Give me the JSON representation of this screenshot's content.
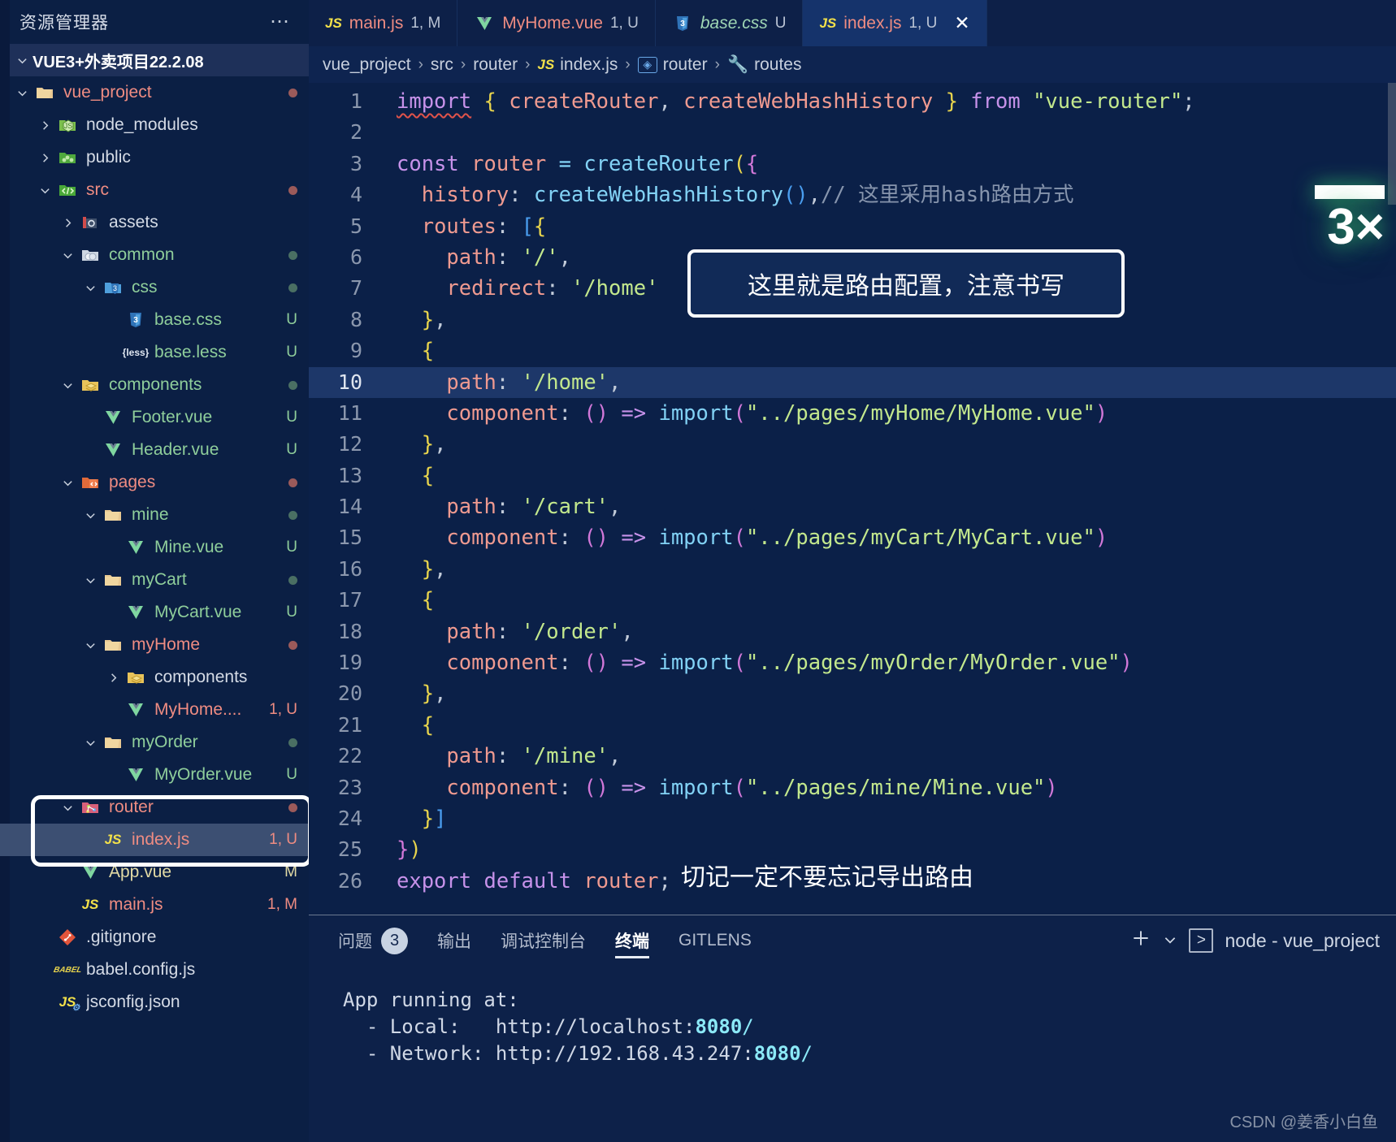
{
  "sidebar": {
    "title": "资源管理器",
    "more_icon": "ellipsis-icon",
    "root": "VUE3+外卖项目22.2.08",
    "items": [
      {
        "label": "vue_project",
        "badge": "",
        "indent": 1,
        "icon": "folder-open-icon",
        "color": "red",
        "arrow": "down",
        "dot": "red"
      },
      {
        "label": "node_modules",
        "badge": "",
        "indent": 2,
        "icon": "node-folder-icon",
        "color": "plain",
        "arrow": "right",
        "dot": ""
      },
      {
        "label": "public",
        "badge": "",
        "indent": 2,
        "icon": "public-folder-icon",
        "color": "plain",
        "arrow": "right",
        "dot": ""
      },
      {
        "label": "src",
        "badge": "",
        "indent": 2,
        "icon": "src-folder-icon",
        "color": "red",
        "arrow": "down",
        "dot": "red"
      },
      {
        "label": "assets",
        "badge": "",
        "indent": 3,
        "icon": "assets-folder-icon",
        "color": "plain",
        "arrow": "right",
        "dot": ""
      },
      {
        "label": "common",
        "badge": "",
        "indent": 3,
        "icon": "common-folder-icon",
        "color": "green",
        "arrow": "down",
        "dot": "green"
      },
      {
        "label": "css",
        "badge": "",
        "indent": 4,
        "icon": "css-folder-icon",
        "color": "green",
        "arrow": "down",
        "dot": "green"
      },
      {
        "label": "base.css",
        "badge": "U",
        "indent": 5,
        "icon": "css-file-icon",
        "color": "green",
        "arrow": "",
        "dot": ""
      },
      {
        "label": "base.less",
        "badge": "U",
        "indent": 5,
        "icon": "less-file-icon",
        "color": "green",
        "arrow": "",
        "dot": ""
      },
      {
        "label": "components",
        "badge": "",
        "indent": 3,
        "icon": "components-folder-icon",
        "color": "green",
        "arrow": "down",
        "dot": "green"
      },
      {
        "label": "Footer.vue",
        "badge": "U",
        "indent": 4,
        "icon": "vue-file-icon",
        "color": "green",
        "arrow": "",
        "dot": ""
      },
      {
        "label": "Header.vue",
        "badge": "U",
        "indent": 4,
        "icon": "vue-file-icon",
        "color": "green",
        "arrow": "",
        "dot": ""
      },
      {
        "label": "pages",
        "badge": "",
        "indent": 3,
        "icon": "pages-folder-icon",
        "color": "red",
        "arrow": "down",
        "dot": "red"
      },
      {
        "label": "mine",
        "badge": "",
        "indent": 4,
        "icon": "folder-open-icon",
        "color": "green",
        "arrow": "down",
        "dot": "green"
      },
      {
        "label": "Mine.vue",
        "badge": "U",
        "indent": 5,
        "icon": "vue-file-icon",
        "color": "green",
        "arrow": "",
        "dot": ""
      },
      {
        "label": "myCart",
        "badge": "",
        "indent": 4,
        "icon": "folder-open-icon",
        "color": "green",
        "arrow": "down",
        "dot": "green"
      },
      {
        "label": "MyCart.vue",
        "badge": "U",
        "indent": 5,
        "icon": "vue-file-icon",
        "color": "green",
        "arrow": "",
        "dot": ""
      },
      {
        "label": "myHome",
        "badge": "",
        "indent": 4,
        "icon": "folder-open-icon",
        "color": "red",
        "arrow": "down",
        "dot": "red"
      },
      {
        "label": "components",
        "badge": "",
        "indent": 5,
        "icon": "components-folder-icon",
        "color": "plain",
        "arrow": "right",
        "dot": ""
      },
      {
        "label": "MyHome....",
        "badge": "1, U",
        "indent": 5,
        "icon": "vue-file-icon",
        "color": "red",
        "arrow": "",
        "dot": ""
      },
      {
        "label": "myOrder",
        "badge": "",
        "indent": 4,
        "icon": "folder-open-icon",
        "color": "green",
        "arrow": "down",
        "dot": "green"
      },
      {
        "label": "MyOrder.vue",
        "badge": "U",
        "indent": 5,
        "icon": "vue-file-icon",
        "color": "green",
        "arrow": "",
        "dot": ""
      },
      {
        "label": "router",
        "badge": "",
        "indent": 3,
        "icon": "router-folder-icon",
        "color": "red",
        "arrow": "down",
        "dot": "red"
      },
      {
        "label": "index.js",
        "badge": "1, U",
        "indent": 4,
        "icon": "js-file-icon",
        "color": "red",
        "arrow": "",
        "dot": "",
        "selected": true
      },
      {
        "label": "App.vue",
        "badge": "M",
        "indent": 3,
        "icon": "vue-file-icon",
        "color": "yellow",
        "arrow": "",
        "dot": ""
      },
      {
        "label": "main.js",
        "badge": "1, M",
        "indent": 3,
        "icon": "js-file-icon",
        "color": "red",
        "arrow": "",
        "dot": ""
      },
      {
        "label": ".gitignore",
        "badge": "",
        "indent": 2,
        "icon": "git-file-icon",
        "color": "plain",
        "arrow": "",
        "dot": ""
      },
      {
        "label": "babel.config.js",
        "badge": "",
        "indent": 2,
        "icon": "babel-file-icon",
        "color": "plain",
        "arrow": "",
        "dot": ""
      },
      {
        "label": "jsconfig.json",
        "badge": "",
        "indent": 2,
        "icon": "jsconfig-file-icon",
        "color": "plain",
        "arrow": "",
        "dot": ""
      }
    ]
  },
  "tabs": [
    {
      "icon": "js-file-icon",
      "name": "main.js",
      "badge": "1, M",
      "active": false,
      "close": false
    },
    {
      "icon": "vue-file-icon",
      "name": "MyHome.vue",
      "badge": "1, U",
      "active": false,
      "close": false
    },
    {
      "icon": "css-file-icon",
      "name": "base.css",
      "badge": "U",
      "active": false,
      "close": false
    },
    {
      "icon": "js-file-icon",
      "name": "index.js",
      "badge": "1, U",
      "active": true,
      "close": true
    }
  ],
  "breadcrumb": [
    {
      "label": "vue_project",
      "icon": ""
    },
    {
      "label": "src",
      "icon": ""
    },
    {
      "label": "router",
      "icon": ""
    },
    {
      "label": "index.js",
      "icon": "js-file-icon"
    },
    {
      "label": "router",
      "icon": "symbol-variable-icon"
    },
    {
      "label": "routes",
      "icon": "symbol-property-icon"
    }
  ],
  "code": {
    "current_line": 10,
    "lines": [
      {
        "n": 1,
        "html": "<span class='t-kw squiggle'>import</span> <span class='t-br1'>{</span> <span class='t-var'>createRouter</span><span class='t-punc'>,</span> <span class='t-var'>createWebHashHistory</span> <span class='t-br1'>}</span> <span class='t-kw'>from</span> <span class='t-str'>\"vue-router\"</span><span class='t-punc'>;</span>"
      },
      {
        "n": 2,
        "html": ""
      },
      {
        "n": 3,
        "html": "<span class='t-kw'>const</span> <span class='t-var'>router</span> <span class='t-op'>=</span> <span class='t-fn'>createRouter</span><span class='t-br1'>(</span><span class='t-br2'>{</span>"
      },
      {
        "n": 4,
        "html": "  <span class='t-prop'>history</span><span class='t-punc'>:</span> <span class='t-fn'>createWebHashHistory</span><span class='t-br3'>()</span><span class='t-punc'>,</span><span class='t-cmt'>// 这里采用hash路由方式</span>"
      },
      {
        "n": 5,
        "html": "  <span class='t-prop'>routes</span><span class='t-punc'>:</span> <span class='t-br3'>[</span><span class='t-br1'>{</span>"
      },
      {
        "n": 6,
        "html": "    <span class='t-prop'>path</span><span class='t-punc'>:</span> <span class='t-str'>'/'</span><span class='t-punc'>,</span>"
      },
      {
        "n": 7,
        "html": "    <span class='t-prop'>redirect</span><span class='t-punc'>:</span> <span class='t-str'>'/home'</span>"
      },
      {
        "n": 8,
        "html": "  <span class='t-br1'>}</span><span class='t-punc'>,</span>"
      },
      {
        "n": 9,
        "html": "  <span class='t-br1'>{</span>"
      },
      {
        "n": 10,
        "html": "    <span class='t-prop'>path</span><span class='t-punc'>:</span> <span class='t-str'>'/home'</span><span class='t-punc'>,</span>"
      },
      {
        "n": 11,
        "html": "    <span class='t-prop'>component</span><span class='t-punc'>:</span> <span class='t-paren'>()</span> <span class='t-arrow'>=&gt;</span> <span class='t-fn'>import</span><span class='t-paren'>(</span><span class='t-str'>\"../pages/myHome/MyHome.vue\"</span><span class='t-paren'>)</span>"
      },
      {
        "n": 12,
        "html": "  <span class='t-br1'>}</span><span class='t-punc'>,</span>"
      },
      {
        "n": 13,
        "html": "  <span class='t-br1'>{</span>"
      },
      {
        "n": 14,
        "html": "    <span class='t-prop'>path</span><span class='t-punc'>:</span> <span class='t-str'>'/cart'</span><span class='t-punc'>,</span>"
      },
      {
        "n": 15,
        "html": "    <span class='t-prop'>component</span><span class='t-punc'>:</span> <span class='t-paren'>()</span> <span class='t-arrow'>=&gt;</span> <span class='t-fn'>import</span><span class='t-paren'>(</span><span class='t-str'>\"../pages/myCart/MyCart.vue\"</span><span class='t-paren'>)</span>"
      },
      {
        "n": 16,
        "html": "  <span class='t-br1'>}</span><span class='t-punc'>,</span>"
      },
      {
        "n": 17,
        "html": "  <span class='t-br1'>{</span>"
      },
      {
        "n": 18,
        "html": "    <span class='t-prop'>path</span><span class='t-punc'>:</span> <span class='t-str'>'/order'</span><span class='t-punc'>,</span>"
      },
      {
        "n": 19,
        "html": "    <span class='t-prop'>component</span><span class='t-punc'>:</span> <span class='t-paren'>()</span> <span class='t-arrow'>=&gt;</span> <span class='t-fn'>import</span><span class='t-paren'>(</span><span class='t-str'>\"../pages/myOrder/MyOrder.vue\"</span><span class='t-paren'>)</span>"
      },
      {
        "n": 20,
        "html": "  <span class='t-br1'>}</span><span class='t-punc'>,</span>"
      },
      {
        "n": 21,
        "html": "  <span class='t-br1'>{</span>"
      },
      {
        "n": 22,
        "html": "    <span class='t-prop'>path</span><span class='t-punc'>:</span> <span class='t-str'>'/mine'</span><span class='t-punc'>,</span>"
      },
      {
        "n": 23,
        "html": "    <span class='t-prop'>component</span><span class='t-punc'>:</span> <span class='t-paren'>()</span> <span class='t-arrow'>=&gt;</span> <span class='t-fn'>import</span><span class='t-paren'>(</span><span class='t-str'>\"../pages/mine/Mine.vue\"</span><span class='t-paren'>)</span>"
      },
      {
        "n": 24,
        "html": "  <span class='t-br1'>}</span><span class='t-br3'>]</span>"
      },
      {
        "n": 25,
        "html": "<span class='t-br2'>}</span><span class='t-br1'>)</span>"
      },
      {
        "n": 26,
        "html": "<span class='t-kw'>export</span> <span class='t-kw'>default</span> <span class='t-var'>router</span><span class='t-punc'>;</span>"
      }
    ],
    "plain_text": [
      "import { createRouter, createWebHashHistory } from \"vue-router\";",
      "",
      "const router = createRouter({",
      "  history: createWebHashHistory(),// 这里采用hash路由方式",
      "  routes: [{",
      "    path: '/',",
      "    redirect: '/home'",
      "  },",
      "  {",
      "    path: '/home',",
      "    component: () => import(\"../pages/myHome/MyHome.vue\")",
      "  },",
      "  {",
      "    path: '/cart',",
      "    component: () => import(\"../pages/myCart/MyCart.vue\")",
      "  },",
      "  {",
      "    path: '/order',",
      "    component: () => import(\"../pages/myOrder/MyOrder.vue\")",
      "  },",
      "  {",
      "    path: '/mine',",
      "    component: () => import(\"../pages/mine/Mine.vue\")",
      "  }]",
      "})",
      "export default router;"
    ]
  },
  "annotations": {
    "callout_text": "这里就是路由配置，注意书写",
    "inline_note": "切记一定不要忘记导出路由"
  },
  "watermark": {
    "zoom_label": "3×",
    "credit": "CSDN @姜香小白鱼"
  },
  "panel": {
    "tabs": [
      {
        "label": "问题",
        "count": "3",
        "active": false
      },
      {
        "label": "输出",
        "count": "",
        "active": false
      },
      {
        "label": "调试控制台",
        "count": "",
        "active": false
      },
      {
        "label": "终端",
        "count": "",
        "active": true
      },
      {
        "label": "GITLENS",
        "count": "",
        "active": false
      }
    ],
    "add_icon": "plus-icon",
    "chevron_icon": "chevron-down-icon",
    "terminal_icon": "terminal-icon",
    "terminal_name": "node - vue_project",
    "terminal_output": {
      "line1": "App running at:",
      "line2_label": "  - Local:   http://localhost:",
      "line2_port": "8080",
      "line2_tail": "/",
      "line3_label": "  - Network: http://192.168.43.247:",
      "line3_port": "8080",
      "line3_tail": "/"
    }
  },
  "colors": {
    "bg": "#0b1f44",
    "editor_bg": "#0b2048",
    "tab_active": "#15336b",
    "selection": "#3c4f72",
    "accent_green": "#8fce9b",
    "accent_red": "#ef8c82",
    "highlight_border": "#ffffff"
  }
}
